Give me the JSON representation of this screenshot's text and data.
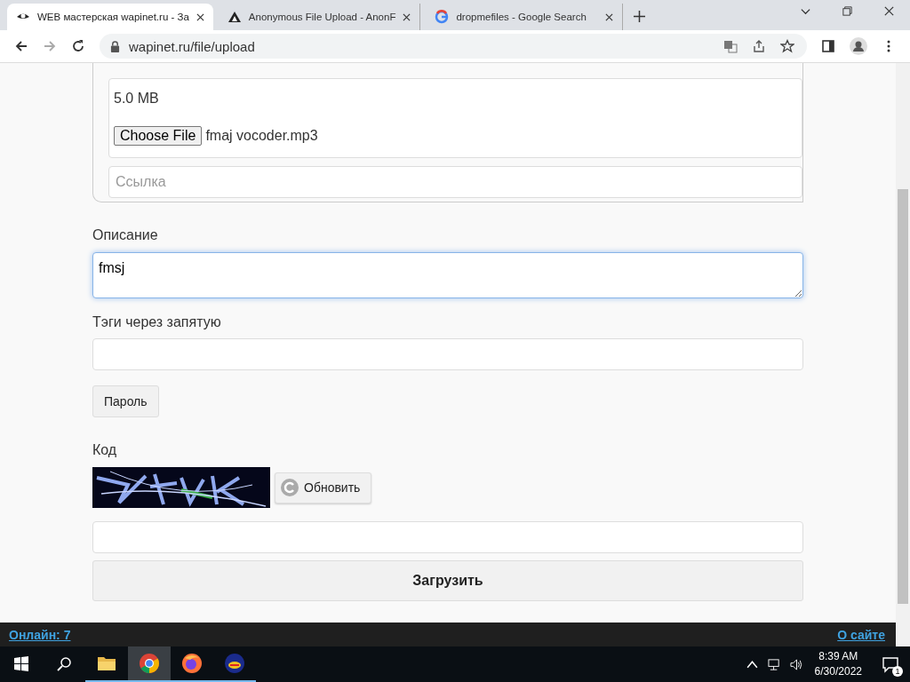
{
  "browser": {
    "tabs": [
      {
        "title": "WEB мастерская wapinet.ru - За",
        "kind": "eye",
        "selected": true
      },
      {
        "title": "Anonymous File Upload - AnonF",
        "kind": "triangle",
        "selected": false
      },
      {
        "title": "dropmefiles - Google Search",
        "kind": "google",
        "selected": false
      }
    ],
    "address": "wapinet.ru/file/upload"
  },
  "form": {
    "file_box": {
      "size": "5.0 MB",
      "button": "Choose File",
      "file_name": "fmaj vocoder.mp3"
    },
    "link_field": {
      "placeholder": "Ссылка"
    },
    "description": {
      "label": "Описание",
      "value": "fmsj",
      "focused": true
    },
    "tags": {
      "label": "Тэги через запятую"
    },
    "password_button": "Пароль",
    "captcha": {
      "label": "Код",
      "refresh_button": "Обновить"
    },
    "submit_button": "Загрузить"
  },
  "footer": {
    "online_link": "Онлайн: 7",
    "about_link": "О сайте"
  },
  "taskbar": {
    "apps": [
      {
        "kind": "folder",
        "selected": false
      },
      {
        "kind": "chrome",
        "selected": true
      },
      {
        "kind": "firefox",
        "selected": false
      },
      {
        "kind": "globe",
        "selected": false
      }
    ],
    "time": "8:39 AM",
    "date": "6/30/2022",
    "notifications": "1"
  }
}
